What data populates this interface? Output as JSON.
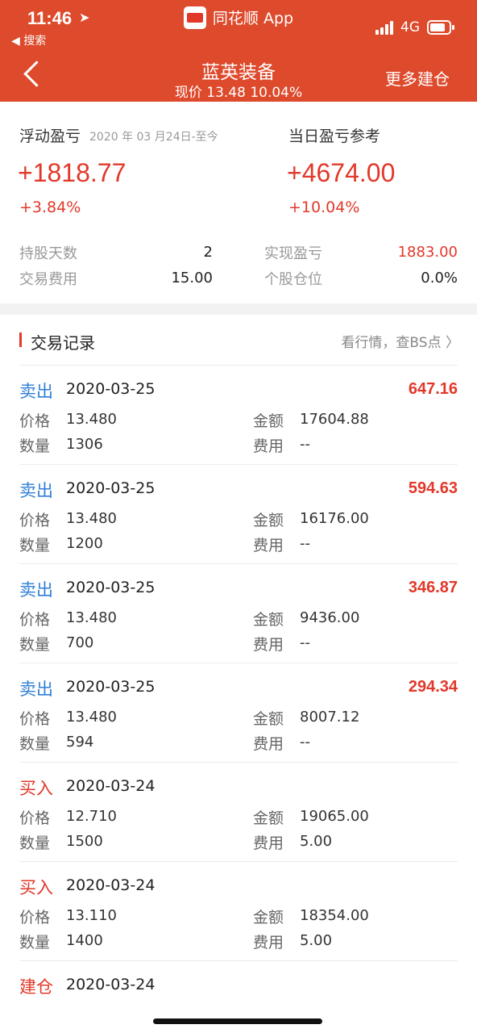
{
  "status": {
    "time": "11:46",
    "back_app": "◀ 搜索",
    "app_name": "同花顺 App",
    "network": "4G"
  },
  "header": {
    "title": "蓝英装备",
    "subtitle": "现价 13.48 10.04%",
    "more": "更多建仓"
  },
  "summary": {
    "float_label": "浮动盈亏",
    "float_range": "2020 年 03 月24日-至今",
    "float_value": "+1818.77",
    "float_pct": "+3.84%",
    "day_label": "当日盈亏参考",
    "day_value": "+4674.00",
    "day_pct": "+10.04%",
    "hold_days_label": "持股天数",
    "hold_days": "2",
    "fee_label": "交易费用",
    "fee": "15.00",
    "realized_label": "实现盈亏",
    "realized": "1883.00",
    "position_label": "个股仓位",
    "position": "0.0%"
  },
  "records": {
    "title": "交易记录",
    "link": "看行情，查BS点 〉",
    "labels": {
      "price": "价格",
      "qty": "数量",
      "amount": "金额",
      "fee": "费用"
    },
    "items": [
      {
        "type": "卖出",
        "kind": "sell",
        "date": "2020-03-25",
        "pl": "647.16",
        "price": "13.480",
        "qty": "1306",
        "amount": "17604.88",
        "fee": "--"
      },
      {
        "type": "卖出",
        "kind": "sell",
        "date": "2020-03-25",
        "pl": "594.63",
        "price": "13.480",
        "qty": "1200",
        "amount": "16176.00",
        "fee": "--"
      },
      {
        "type": "卖出",
        "kind": "sell",
        "date": "2020-03-25",
        "pl": "346.87",
        "price": "13.480",
        "qty": "700",
        "amount": "9436.00",
        "fee": "--"
      },
      {
        "type": "卖出",
        "kind": "sell",
        "date": "2020-03-25",
        "pl": "294.34",
        "price": "13.480",
        "qty": "594",
        "amount": "8007.12",
        "fee": "--"
      },
      {
        "type": "买入",
        "kind": "buy",
        "date": "2020-03-24",
        "pl": "",
        "price": "12.710",
        "qty": "1500",
        "amount": "19065.00",
        "fee": "5.00"
      },
      {
        "type": "买入",
        "kind": "buy",
        "date": "2020-03-24",
        "pl": "",
        "price": "13.110",
        "qty": "1400",
        "amount": "18354.00",
        "fee": "5.00"
      },
      {
        "type": "建仓",
        "kind": "buy",
        "date": "2020-03-24"
      }
    ]
  }
}
